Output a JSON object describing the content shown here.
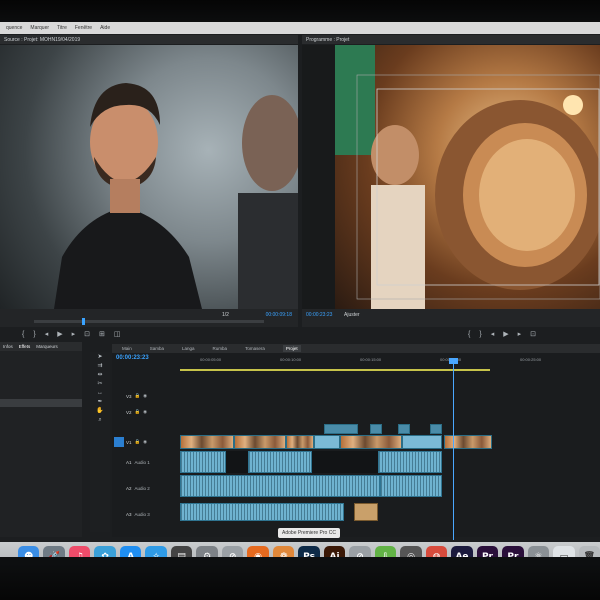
{
  "menubar": {
    "items": [
      "quence",
      "Marquer",
      "Titre",
      "Fenêtre",
      "Aide"
    ]
  },
  "source": {
    "header": "Source : Projet: MOHN19/04/2019",
    "timecode_right": "00:00:09:18",
    "fraction": "1/2"
  },
  "program": {
    "header": "Programme : Projet",
    "timecode_left": "00:00:23:23",
    "fit_label": "Ajuster"
  },
  "project_panel": {
    "tabs": [
      "Infos",
      "Effets",
      "Marqueurs"
    ]
  },
  "timeline": {
    "tabs": [
      "Main",
      "Samba",
      "Langa",
      "Rumba",
      "Tomasera",
      "Projet"
    ],
    "timecode": "00:00:23:23",
    "ruler": [
      "00:00:05:00",
      "00:00:10:00",
      "00:00:15:00",
      "00:00:20:00",
      "00:00:25:00",
      "00:00:30:00"
    ],
    "tracks": [
      {
        "name": "V3"
      },
      {
        "name": "V2"
      },
      {
        "name": "V1"
      },
      {
        "name": "A1",
        "label": "Audio 1"
      },
      {
        "name": "A2",
        "label": "Audio 2"
      },
      {
        "name": "A3",
        "label": "Audio 3"
      }
    ]
  },
  "dock": {
    "tooltip": "Adobe Premiere Pro CC",
    "apps": [
      {
        "icon": "finder-icon",
        "glyph": "☻",
        "color": "#3a8ee6"
      },
      {
        "icon": "launchpad-icon",
        "glyph": "🚀",
        "color": "#6f7b85"
      },
      {
        "icon": "itunes-icon",
        "glyph": "♫",
        "color": "#ee4c6a"
      },
      {
        "icon": "photos-icon",
        "glyph": "✿",
        "color": "#3aa0d8"
      },
      {
        "icon": "app-store-icon",
        "glyph": "A",
        "color": "#1f8ef1"
      },
      {
        "icon": "safari-icon",
        "glyph": "✧",
        "color": "#2f9be6"
      },
      {
        "icon": "clapper-icon",
        "glyph": "▤",
        "color": "#444"
      },
      {
        "icon": "preferences-icon",
        "glyph": "⚙",
        "color": "#7d8287"
      },
      {
        "icon": "no-entry-icon",
        "glyph": "⊘",
        "color": "#9aa0a5"
      },
      {
        "icon": "firefox-icon",
        "glyph": "◉",
        "color": "#e66a1f"
      },
      {
        "icon": "pinwheel-icon",
        "glyph": "❁",
        "color": "#e0883a"
      },
      {
        "icon": "photoshop-icon",
        "glyph": "Ps",
        "color": "#0d2a47"
      },
      {
        "icon": "illustrator-icon",
        "glyph": "Ai",
        "color": "#3a1806"
      },
      {
        "icon": "blocked-icon",
        "glyph": "⊘",
        "color": "#9aa0a5"
      },
      {
        "icon": "download-icon",
        "glyph": "⇩",
        "color": "#62b346"
      },
      {
        "icon": "camera-icon",
        "glyph": "◎",
        "color": "#555"
      },
      {
        "icon": "chrome-icon",
        "glyph": "◍",
        "color": "#d84b3c"
      },
      {
        "icon": "after-effects-icon",
        "glyph": "Ae",
        "color": "#1b1a3d"
      },
      {
        "icon": "premiere-icon",
        "glyph": "Pr",
        "color": "#2a0f3a"
      },
      {
        "icon": "premiere-alt-icon",
        "glyph": "Pr",
        "color": "#2a0f3a"
      },
      {
        "icon": "misc-icon",
        "glyph": "⚛",
        "color": "#8a9095"
      },
      {
        "icon": "document-icon",
        "glyph": "▭",
        "color": "#dfe3e6"
      },
      {
        "icon": "trash-icon",
        "glyph": "🗑",
        "color": "#b6babd"
      }
    ]
  }
}
